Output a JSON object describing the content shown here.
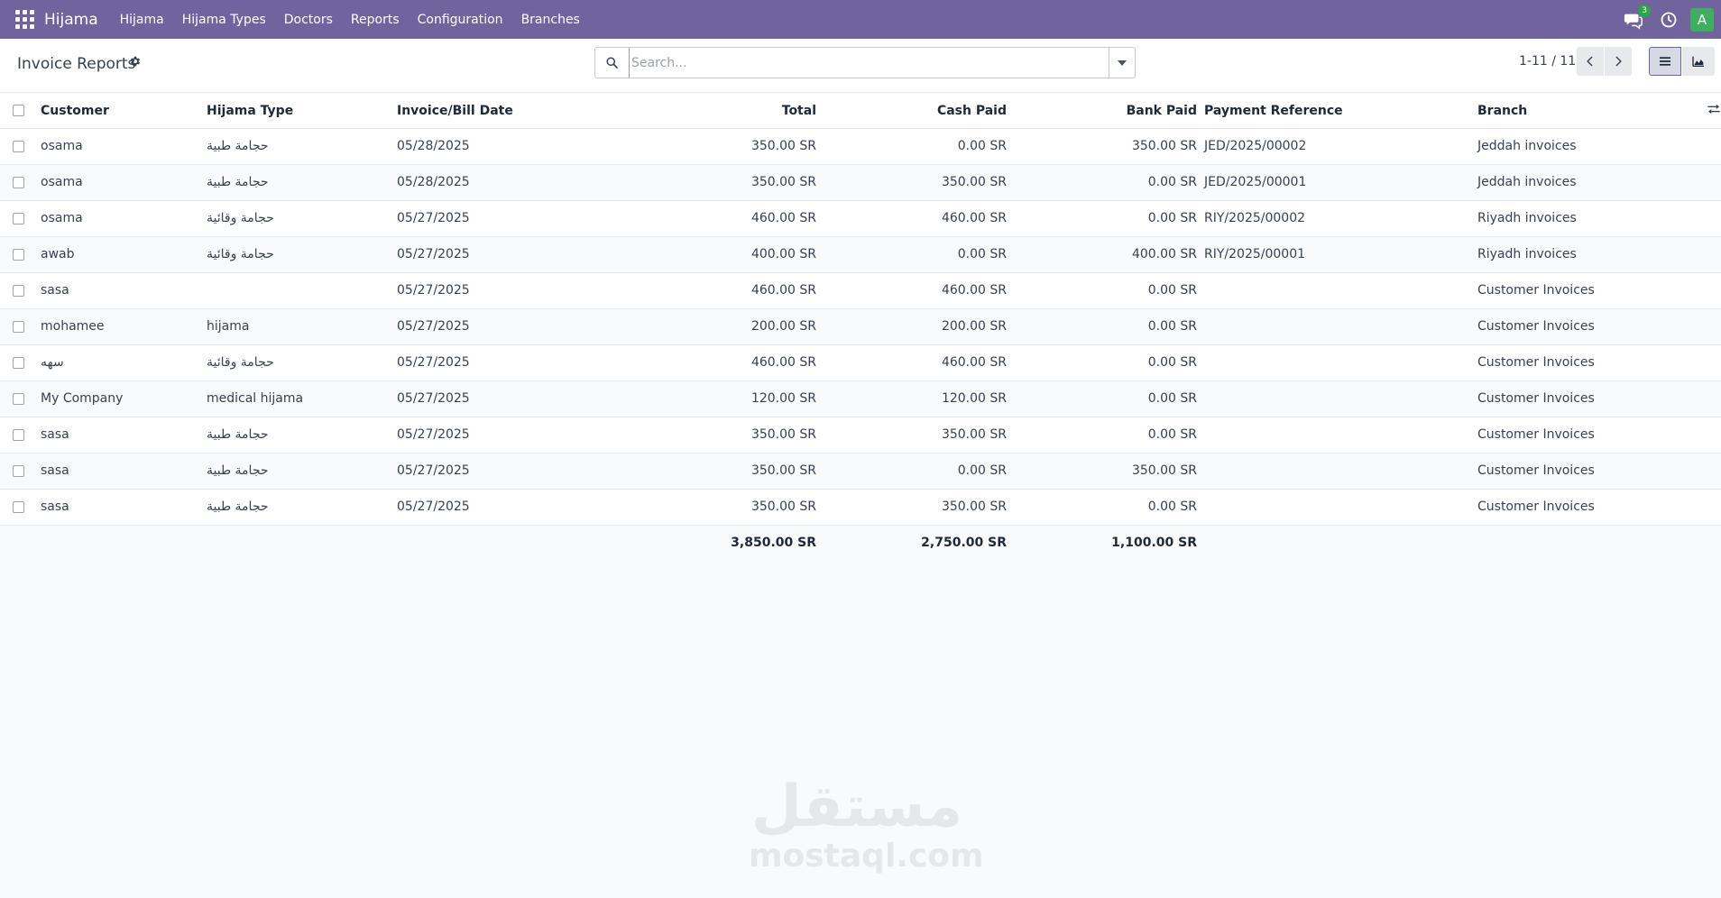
{
  "navbar": {
    "brand": "Hijama",
    "menu": [
      "Hijama",
      "Hijama Types",
      "Doctors",
      "Reports",
      "Configuration",
      "Branches"
    ],
    "chat_badge": "3",
    "avatar_letter": "A"
  },
  "control_panel": {
    "title": "Invoice Reports",
    "search_placeholder": "Search...",
    "pager": "1-11 / 11"
  },
  "table": {
    "columns": [
      "Customer",
      "Hijama Type",
      "Invoice/Bill Date",
      "Total",
      "Cash Paid",
      "Bank Paid",
      "Payment Reference",
      "Branch"
    ],
    "rows": [
      [
        "osama",
        "حجامة طبية",
        "05/28/2025",
        "350.00 SR",
        "0.00 SR",
        "350.00 SR",
        "JED/2025/00002",
        "Jeddah invoices"
      ],
      [
        "osama",
        "حجامة طبية",
        "05/28/2025",
        "350.00 SR",
        "350.00 SR",
        "0.00 SR",
        "JED/2025/00001",
        "Jeddah invoices"
      ],
      [
        "osama",
        "حجامة وقائية",
        "05/27/2025",
        "460.00 SR",
        "460.00 SR",
        "0.00 SR",
        "RIY/2025/00002",
        "Riyadh invoices"
      ],
      [
        "awab",
        "حجامة وقائية",
        "05/27/2025",
        "400.00 SR",
        "0.00 SR",
        "400.00 SR",
        "RIY/2025/00001",
        "Riyadh invoices"
      ],
      [
        "sasa",
        "",
        "05/27/2025",
        "460.00 SR",
        "460.00 SR",
        "0.00 SR",
        "",
        "Customer Invoices"
      ],
      [
        "mohamee",
        "hijama",
        "05/27/2025",
        "200.00 SR",
        "200.00 SR",
        "0.00 SR",
        "",
        "Customer Invoices"
      ],
      [
        "سهه",
        "حجامة وقائية",
        "05/27/2025",
        "460.00 SR",
        "460.00 SR",
        "0.00 SR",
        "",
        "Customer Invoices"
      ],
      [
        "My Company",
        "medical hijama",
        "05/27/2025",
        "120.00 SR",
        "120.00 SR",
        "0.00 SR",
        "",
        "Customer Invoices"
      ],
      [
        "sasa",
        "حجامة طبية",
        "05/27/2025",
        "350.00 SR",
        "350.00 SR",
        "0.00 SR",
        "",
        "Customer Invoices"
      ],
      [
        "sasa",
        "حجامة طبية",
        "05/27/2025",
        "350.00 SR",
        "0.00 SR",
        "350.00 SR",
        "",
        "Customer Invoices"
      ],
      [
        "sasa",
        "حجامة طبية",
        "05/27/2025",
        "350.00 SR",
        "350.00 SR",
        "0.00 SR",
        "",
        "Customer Invoices"
      ]
    ],
    "totals": {
      "total": "3,850.00 SR",
      "cash_paid": "2,750.00 SR",
      "bank_paid": "1,100.00 SR"
    }
  },
  "watermark": {
    "arabic": "مستقل",
    "latin": "mostaql.com"
  }
}
